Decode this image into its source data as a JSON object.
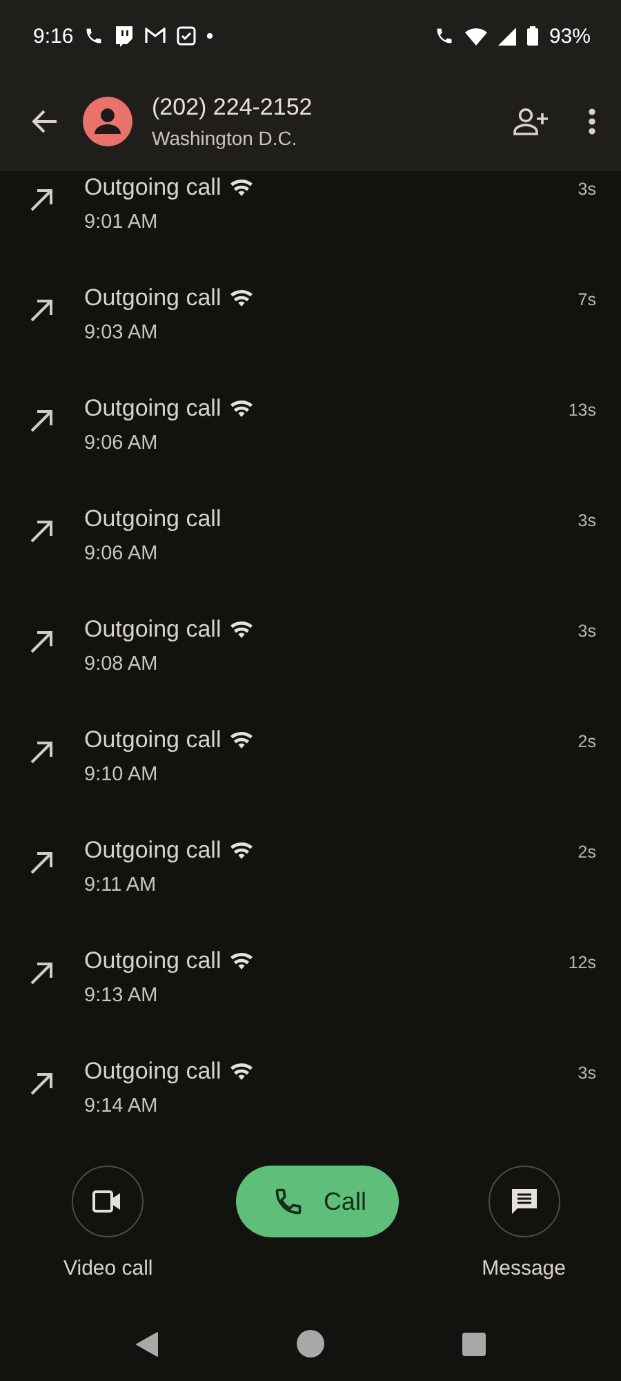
{
  "status_bar": {
    "time": "9:16",
    "battery": "93%"
  },
  "header": {
    "title": "(202) 224-2152",
    "subtitle": "Washington D.C."
  },
  "calls": [
    {
      "label": "Outgoing call",
      "time": "9:01 AM",
      "duration": "3s",
      "wifi": true
    },
    {
      "label": "Outgoing call",
      "time": "9:03 AM",
      "duration": "7s",
      "wifi": true
    },
    {
      "label": "Outgoing call",
      "time": "9:06 AM",
      "duration": "13s",
      "wifi": true
    },
    {
      "label": "Outgoing call",
      "time": "9:06 AM",
      "duration": "3s",
      "wifi": false
    },
    {
      "label": "Outgoing call",
      "time": "9:08 AM",
      "duration": "3s",
      "wifi": true
    },
    {
      "label": "Outgoing call",
      "time": "9:10 AM",
      "duration": "2s",
      "wifi": true
    },
    {
      "label": "Outgoing call",
      "time": "9:11 AM",
      "duration": "2s",
      "wifi": true
    },
    {
      "label": "Outgoing call",
      "time": "9:13 AM",
      "duration": "12s",
      "wifi": true
    },
    {
      "label": "Outgoing call",
      "time": "9:14 AM",
      "duration": "3s",
      "wifi": true
    }
  ],
  "actions": [
    {
      "kind": "video",
      "label": "Video call"
    },
    {
      "kind": "call",
      "label": "Call"
    },
    {
      "kind": "message",
      "label": "Message"
    }
  ]
}
